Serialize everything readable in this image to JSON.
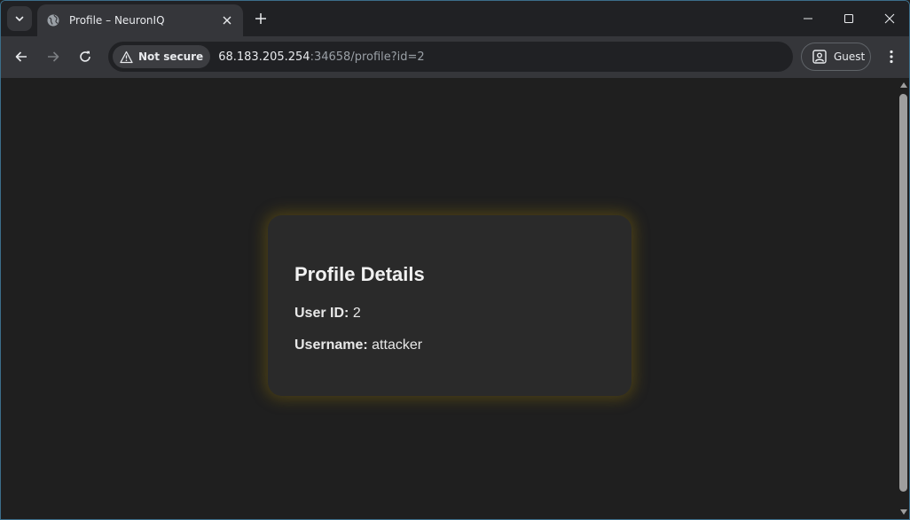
{
  "browser": {
    "tab": {
      "title": "Profile – NeuronIQ"
    },
    "omnibox": {
      "security_label": "Not secure",
      "url_host": "68.183.205.254",
      "url_rest": ":34658/profile?id=2"
    },
    "profile_button_label": "Guest",
    "icons": {
      "tab_search": "chevron-down-icon",
      "favicon": "globe-icon",
      "close_tab": "close-icon",
      "new_tab": "plus-icon",
      "minimize": "minimize-icon",
      "maximize": "maximize-icon",
      "close_window": "close-icon",
      "back": "back-arrow-icon",
      "forward": "forward-arrow-icon",
      "reload": "reload-icon",
      "security": "warning-triangle-icon",
      "guest": "guest-profile-icon",
      "menu": "kebab-menu-icon"
    }
  },
  "page": {
    "heading": "Profile Details",
    "fields": [
      {
        "label": "User ID:",
        "value": "2"
      },
      {
        "label": "Username:",
        "value": "attacker"
      }
    ]
  },
  "colors": {
    "page_background": "#1f1f1f",
    "card_background": "#2a2a2a",
    "card_glow": "#80680a",
    "toolbar": "#35363a",
    "tabstrip": "#202124"
  }
}
